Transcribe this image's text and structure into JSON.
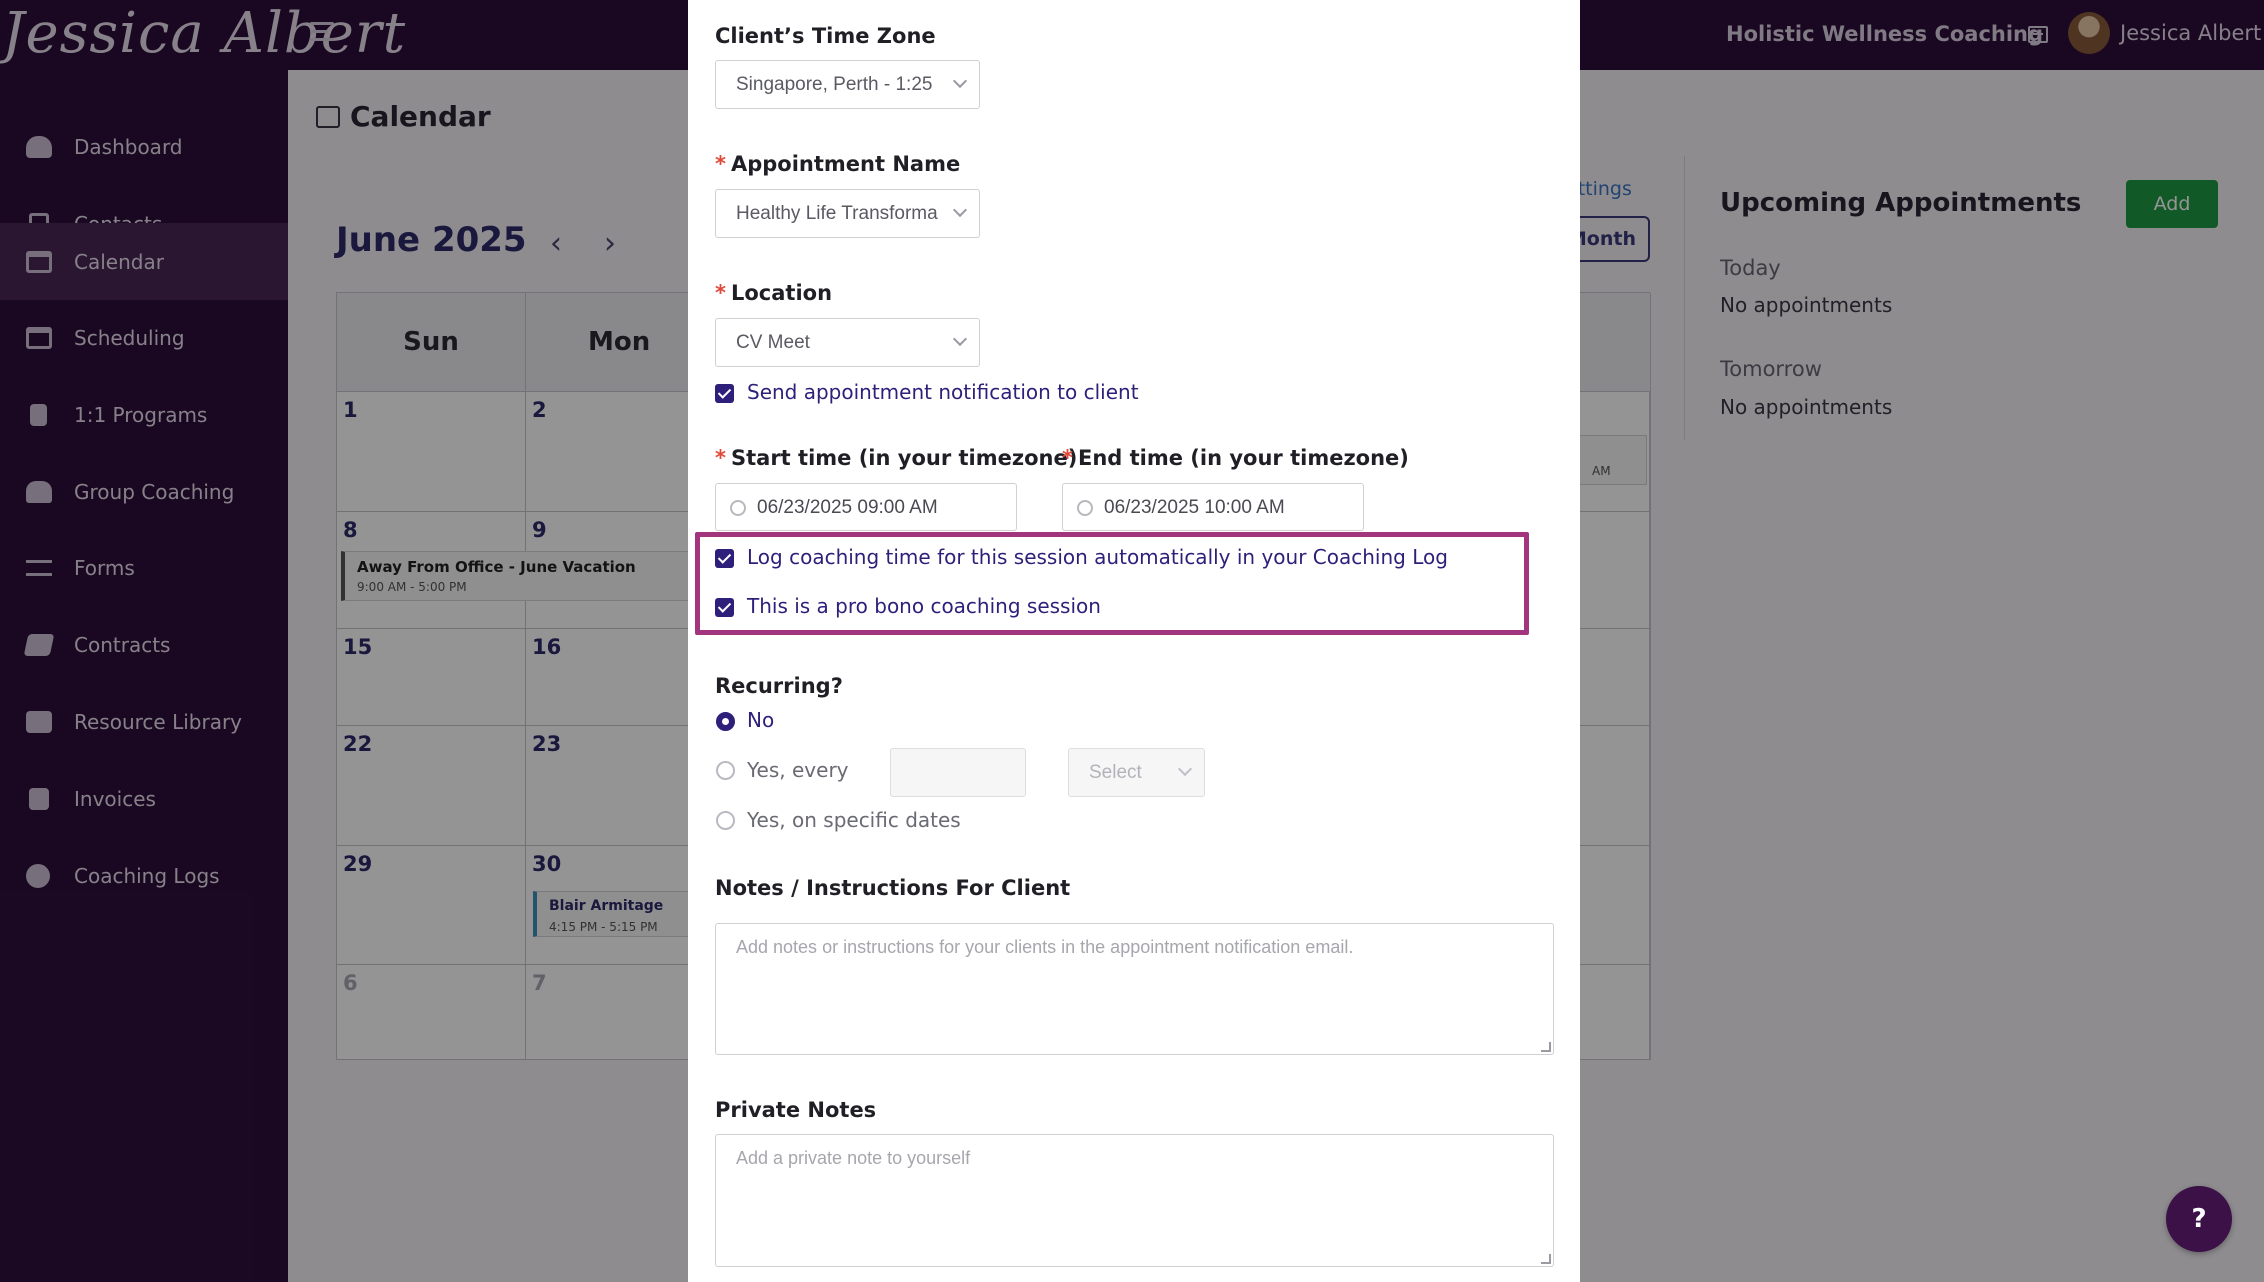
{
  "topbar": {
    "logo_text": "Jessica Albert",
    "workspace_name": "Holistic Wellness Coaching",
    "user_name": "Jessica Albert"
  },
  "sidebar": {
    "items": [
      {
        "label": "Dashboard",
        "icon": "dashboard-icon"
      },
      {
        "label": "Contacts",
        "icon": "contacts-icon"
      },
      {
        "label": "Calendar",
        "icon": "calendar-icon",
        "active": true
      },
      {
        "label": "Scheduling",
        "icon": "scheduling-icon"
      },
      {
        "label": "1:1 Programs",
        "icon": "book-icon"
      },
      {
        "label": "Group Coaching",
        "icon": "group-icon"
      },
      {
        "label": "Forms",
        "icon": "forms-icon"
      },
      {
        "label": "Contracts",
        "icon": "contract-icon"
      },
      {
        "label": "Resource Library",
        "icon": "library-icon"
      },
      {
        "label": "Invoices",
        "icon": "invoice-icon"
      },
      {
        "label": "Coaching Logs",
        "icon": "clock-icon"
      }
    ]
  },
  "calendar": {
    "title": "Calendar",
    "month_label": "June 2025",
    "prev_symbol": "‹",
    "next_symbol": "›",
    "day_headers": [
      "Sun",
      "Mon"
    ],
    "weeks": [
      [
        "1",
        "2"
      ],
      [
        "8",
        "9"
      ],
      [
        "15",
        "16"
      ],
      [
        "22",
        "23"
      ],
      [
        "29",
        "30"
      ],
      [
        "6",
        "7"
      ]
    ],
    "events": {
      "vacation": {
        "title": "Away From Office - June Vacation",
        "time": "9:00 AM - 5:00 PM"
      },
      "blair": {
        "title": "Blair Armitage",
        "time": "4:15 PM - 5:15 PM"
      },
      "partial_time": "AM"
    },
    "settings_link": "ettings",
    "month_button": "Month"
  },
  "upcoming": {
    "title": "Upcoming Appointments",
    "add_label": "Add",
    "today_label": "Today",
    "today_value": "No appointments",
    "tomorrow_label": "Tomorrow",
    "tomorrow_value": "No appointments"
  },
  "modal": {
    "timezone_label": "Client’s Time Zone",
    "timezone_value": "Singapore, Perth - 1:25",
    "required_mark": "*",
    "appointment_label": "Appointment Name",
    "appointment_value": "Healthy Life Transforma",
    "location_label": "Location",
    "location_value": "CV Meet",
    "notify_label": "Send appointment notification to client",
    "start_label": "Start time (in your timezone)",
    "start_value": "06/23/2025 09:00 AM",
    "end_label": "End time (in your timezone)",
    "end_value": "06/23/2025 10:00 AM",
    "log_label": "Log coaching time for this session automatically in your Coaching Log",
    "probono_label": "This is a pro bono coaching session",
    "recurring_label": "Recurring?",
    "recurring_options": {
      "no": "No",
      "yes_every": "Yes, every",
      "specific": "Yes, on specific dates"
    },
    "recurring_select": "Select",
    "notes_label": "Notes / Instructions For Client",
    "notes_placeholder": "Add notes or instructions for your clients in the appointment notification email.",
    "private_label": "Private Notes",
    "private_placeholder": "Add a private note to yourself"
  },
  "help": {
    "label": "?"
  },
  "colors": {
    "brand": "#2e0d3a",
    "accent": "#2e1f7a",
    "highlight": "#a3347e",
    "add": "#1e9a44"
  }
}
